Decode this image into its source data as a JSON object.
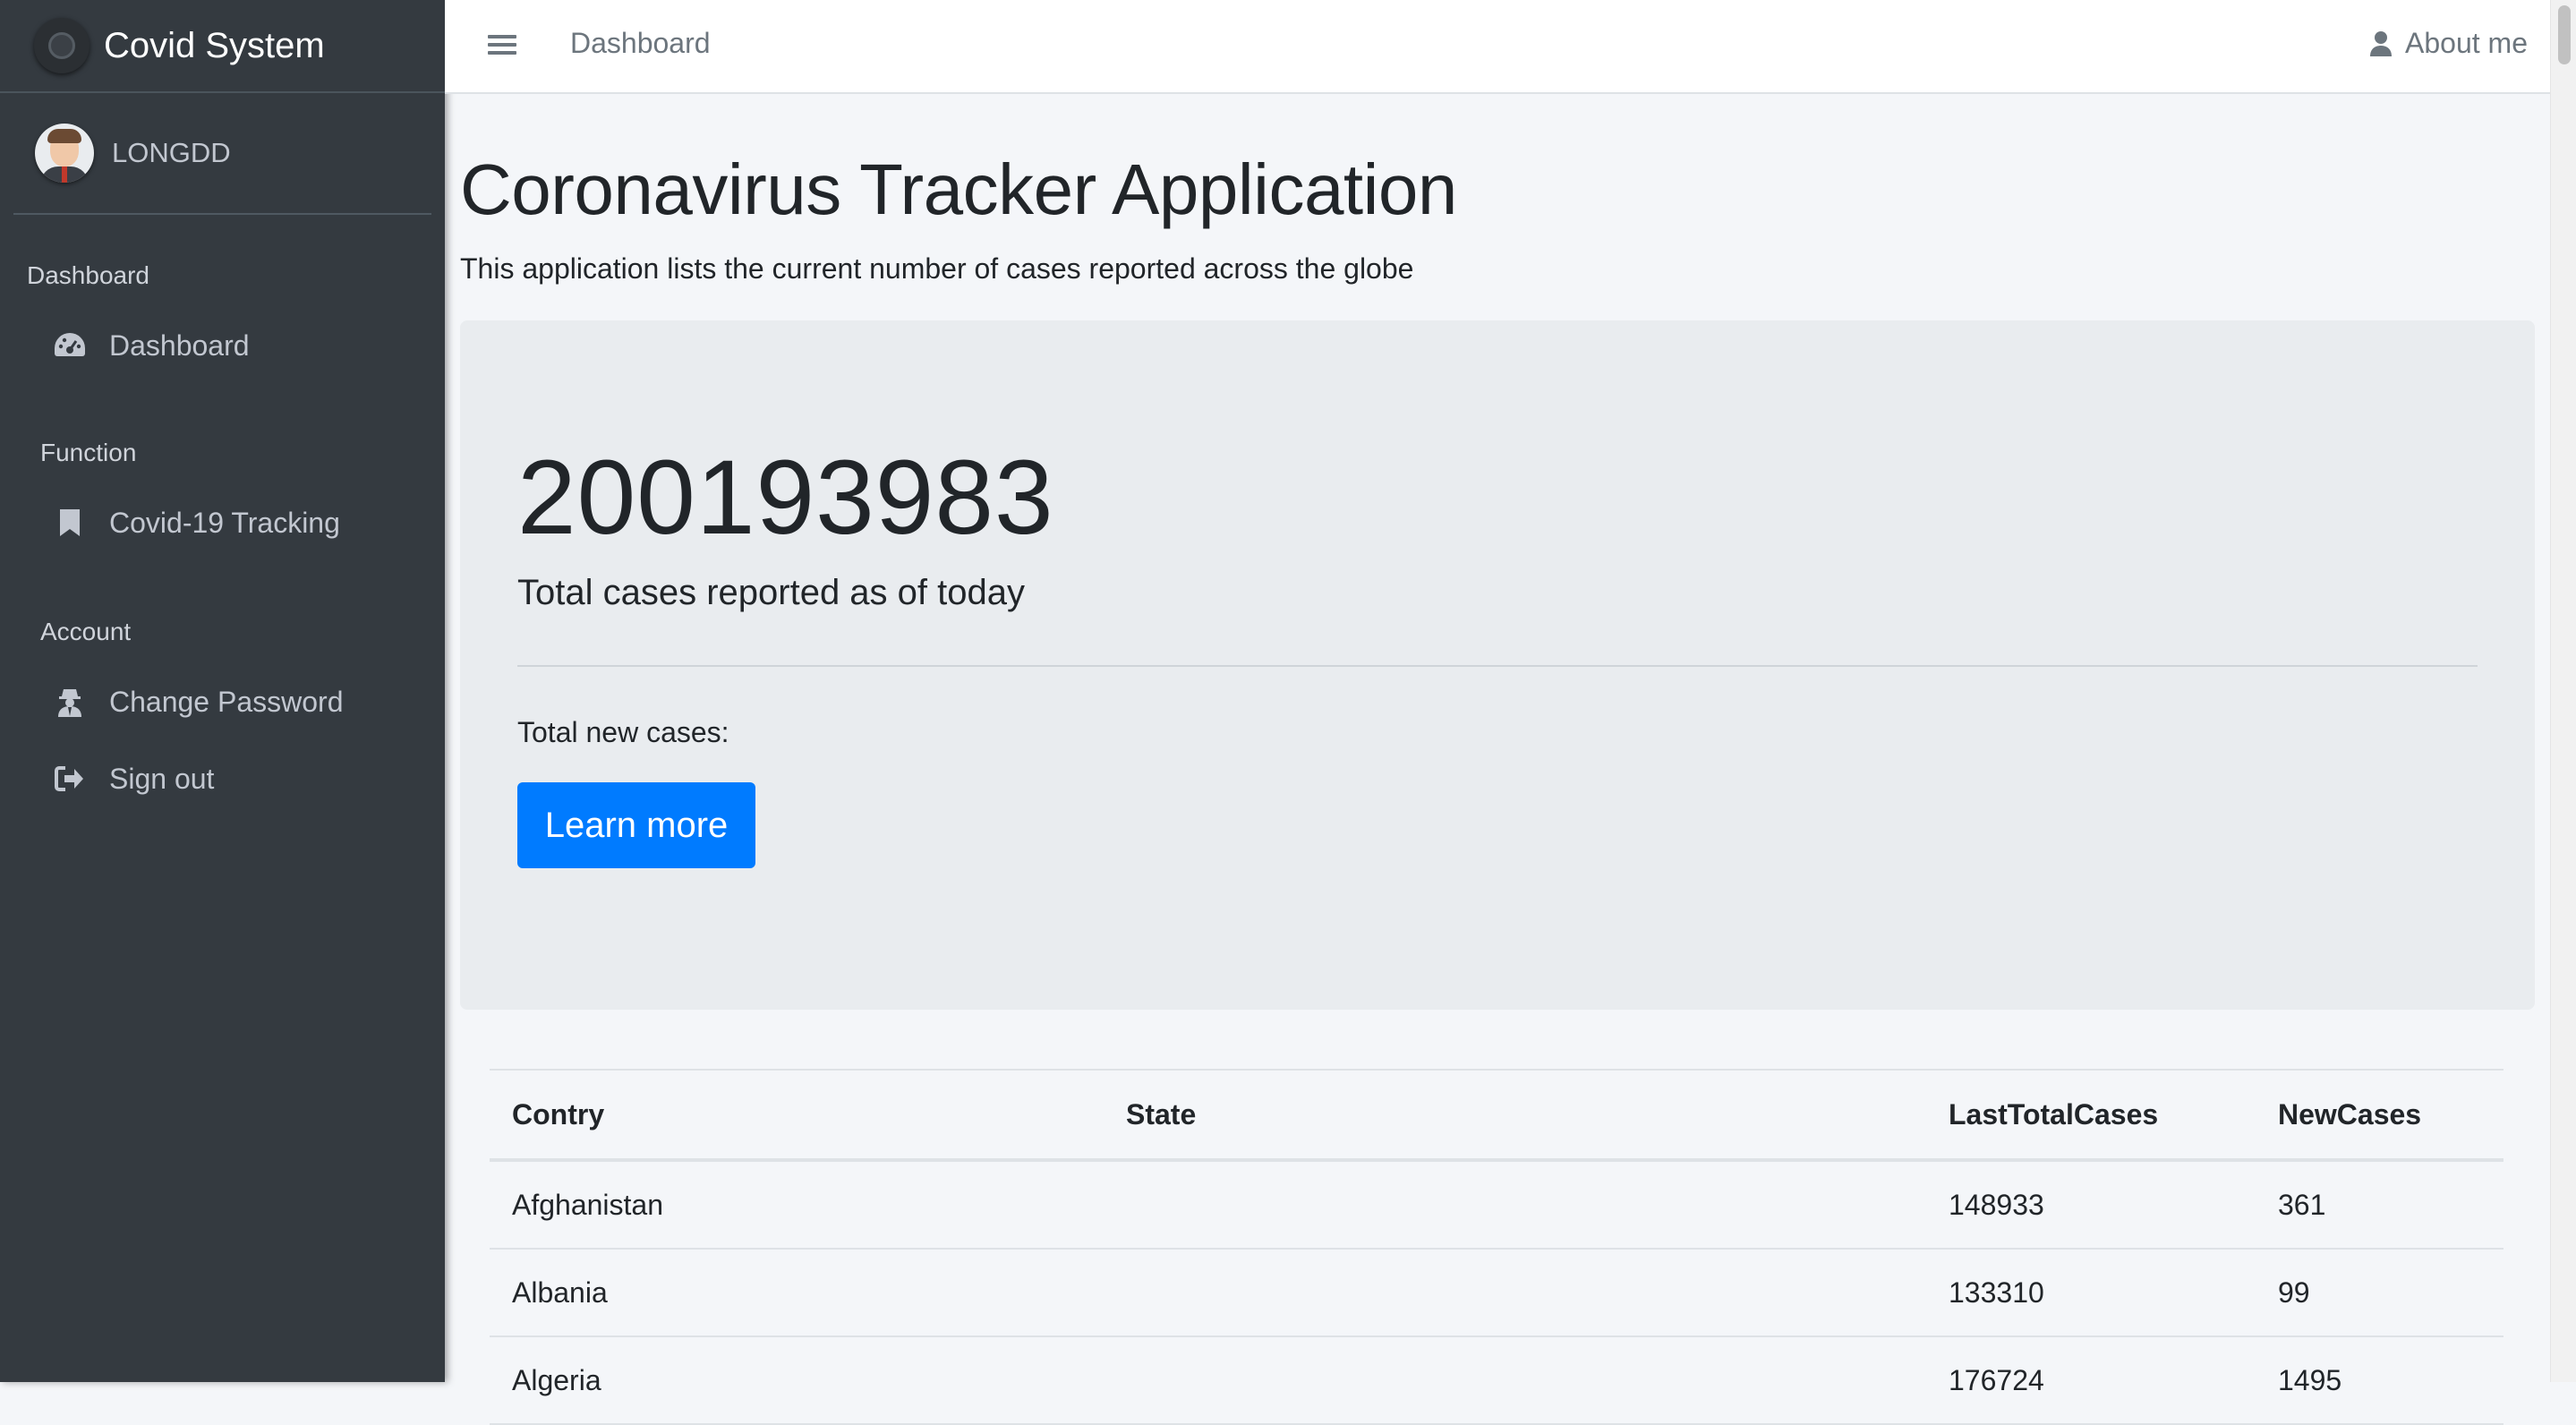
{
  "sidebar": {
    "brand": "Covid System",
    "user": "LONGDD",
    "sections": [
      {
        "header": "Dashboard",
        "items": [
          {
            "label": "Dashboard",
            "icon": "tachometer-icon"
          }
        ]
      },
      {
        "header": "Function",
        "items": [
          {
            "label": "Covid-19 Tracking",
            "icon": "bookmark-icon"
          }
        ]
      },
      {
        "header": "Account",
        "items": [
          {
            "label": "Change Password",
            "icon": "user-secret-icon"
          },
          {
            "label": "Sign out",
            "icon": "sign-out-icon"
          }
        ]
      }
    ]
  },
  "topbar": {
    "dashboard_link": "Dashboard",
    "about_link": "About me"
  },
  "main": {
    "title": "Coronavirus Tracker Application",
    "subtitle": "This application lists the current number of cases reported across the globe",
    "total_cases": "200193983",
    "total_caption": "Total cases reported as of today",
    "new_cases_label": "Total new cases:",
    "learn_more": "Learn more"
  },
  "table": {
    "headers": [
      "Contry",
      "State",
      "LastTotalCases",
      "NewCases"
    ],
    "rows": [
      [
        "Afghanistan",
        "",
        "148933",
        "361"
      ],
      [
        "Albania",
        "",
        "133310",
        "99"
      ],
      [
        "Algeria",
        "",
        "176724",
        "1495"
      ]
    ]
  },
  "colors": {
    "sidebar_bg": "#343a40",
    "content_bg": "#f4f6f9",
    "jumbotron_bg": "#e9ecef",
    "primary": "#007bff"
  }
}
